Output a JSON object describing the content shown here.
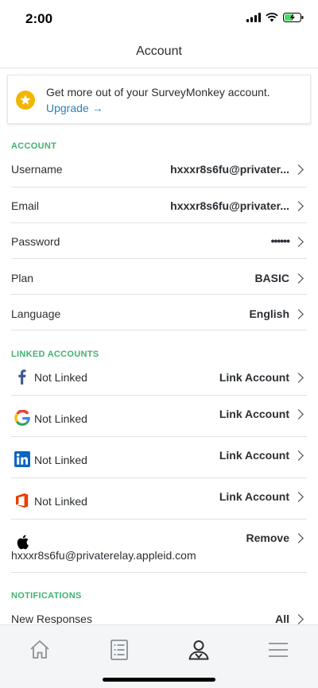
{
  "status_bar": {
    "time": "2:00"
  },
  "nav": {
    "title": "Account"
  },
  "upgrade": {
    "message": "Get more out of your SurveyMonkey account.",
    "link": "Upgrade →"
  },
  "account": {
    "header": "ACCOUNT",
    "rows": [
      {
        "label": "Username",
        "value": "hxxxr8s6fu@privater..."
      },
      {
        "label": "Email",
        "value": "hxxxr8s6fu@privater..."
      },
      {
        "label": "Password",
        "value": "••••••"
      },
      {
        "label": "Plan",
        "value": "BASIC"
      },
      {
        "label": "Language",
        "value": "English"
      }
    ]
  },
  "linked": {
    "header": "LINKED ACCOUNTS",
    "rows": [
      {
        "icon": "facebook-icon",
        "status": "Not Linked",
        "action": "Link Account"
      },
      {
        "icon": "google-icon",
        "status": "Not Linked",
        "action": "Link Account"
      },
      {
        "icon": "linkedin-icon",
        "status": "Not Linked",
        "action": "Link Account"
      },
      {
        "icon": "office-icon",
        "status": "Not Linked",
        "action": "Link Account"
      }
    ],
    "apple": {
      "icon": "apple-icon",
      "email": "hxxxr8s6fu@privaterelay.appleid.com",
      "action": "Remove"
    }
  },
  "notifications": {
    "header": "NOTIFICATIONS",
    "rows": [
      {
        "label": "New Responses",
        "value": "All"
      }
    ]
  },
  "tabs": [
    {
      "icon": "home-icon",
      "active": false
    },
    {
      "icon": "surveys-icon",
      "active": false
    },
    {
      "icon": "account-icon",
      "active": true
    },
    {
      "icon": "menu-icon",
      "active": false
    }
  ],
  "colors": {
    "accent_green": "#3fb36f",
    "link_blue": "#2c7fb8",
    "star_yellow": "#f2b600"
  }
}
